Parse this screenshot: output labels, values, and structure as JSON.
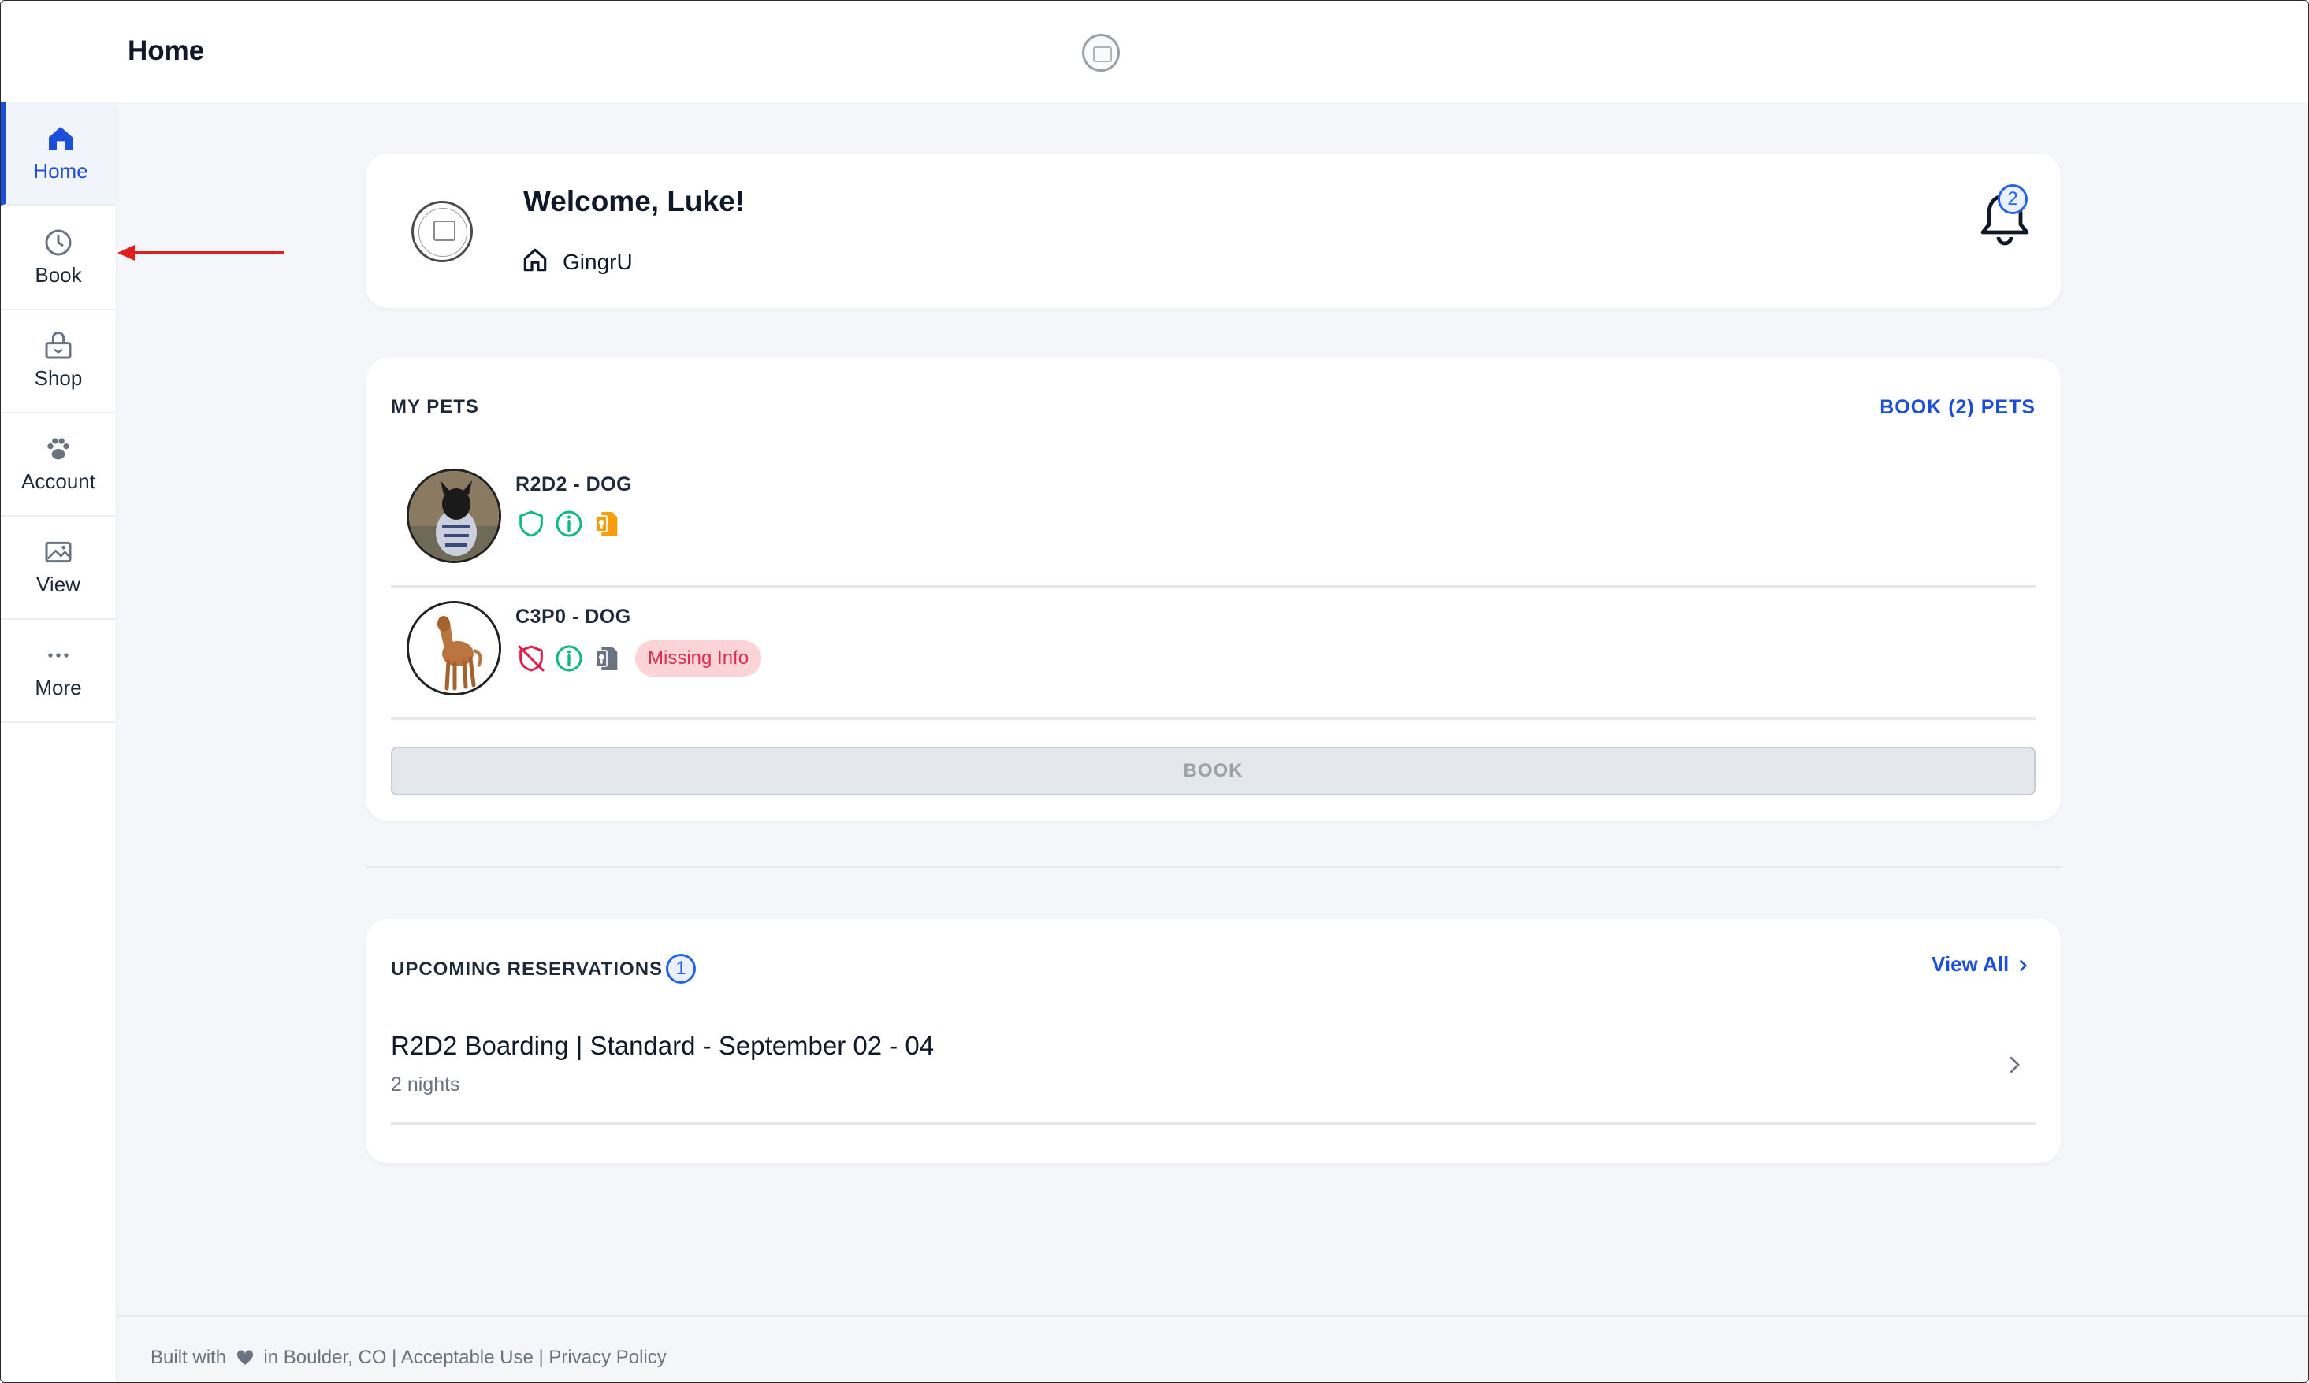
{
  "header": {
    "title": "Home"
  },
  "sidebar": {
    "items": [
      {
        "label": "Home",
        "icon": "home-icon",
        "active": true
      },
      {
        "label": "Book",
        "icon": "clock-icon"
      },
      {
        "label": "Shop",
        "icon": "shop-icon"
      },
      {
        "label": "Account",
        "icon": "paw-icon"
      },
      {
        "label": "View",
        "icon": "gallery-icon"
      },
      {
        "label": "More",
        "icon": "more-dots-icon"
      }
    ]
  },
  "welcome": {
    "title": "Welcome, Luke!",
    "location": "GingrU",
    "notification_count": "2"
  },
  "pets": {
    "section_title": "MY PETS",
    "book_link": "BOOK (2) PETS",
    "items": [
      {
        "name": "R2D2 - DOG",
        "icons": [
          "shield-check-icon",
          "info-icon",
          "document-icon"
        ],
        "badge": ""
      },
      {
        "name": "C3P0 - DOG",
        "icons": [
          "shield-off-icon",
          "info-icon",
          "document-icon"
        ],
        "badge": "Missing Info"
      }
    ],
    "book_button": "BOOK"
  },
  "reservations": {
    "section_title": "UPCOMING RESERVATIONS",
    "count": "1",
    "view_all": "View All",
    "items": [
      {
        "title": "R2D2 Boarding | Standard - September 02 - 04",
        "subtitle": "2 nights"
      }
    ]
  },
  "footer": {
    "prefix": "Built with",
    "suffix": "in Boulder, CO | Acceptable Use | Privacy Policy"
  },
  "colors": {
    "accent": "#1d4ed8",
    "success": "#10b981",
    "warning": "#f59e0b",
    "danger": "#e11d48"
  }
}
